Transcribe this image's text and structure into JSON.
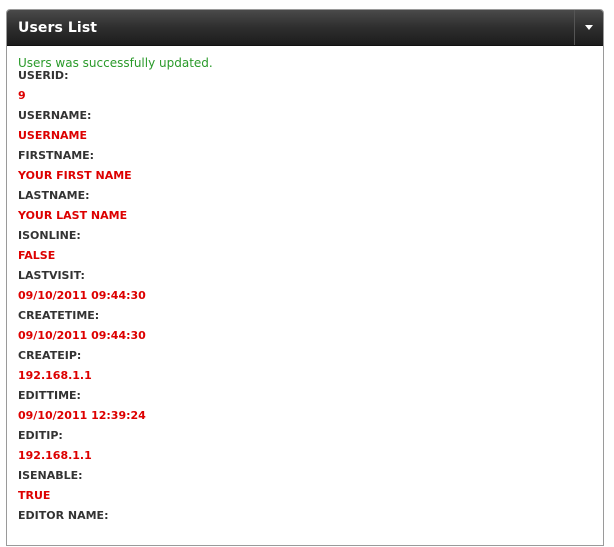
{
  "panel": {
    "title": "Users List",
    "toggle_icon": "chevron-down-icon"
  },
  "message": "Users was successfully updated.",
  "fields": [
    {
      "label": "USERID:",
      "value": "9"
    },
    {
      "label": "USERNAME:",
      "value": "USERNAME"
    },
    {
      "label": "FIRSTNAME:",
      "value": "YOUR FIRST NAME"
    },
    {
      "label": "LASTNAME:",
      "value": "YOUR LAST NAME"
    },
    {
      "label": "ISONLINE:",
      "value": "FALSE"
    },
    {
      "label": "LASTVISIT:",
      "value": "09/10/2011 09:44:30"
    },
    {
      "label": "CREATETIME:",
      "value": "09/10/2011 09:44:30"
    },
    {
      "label": "CREATEIP:",
      "value": "192.168.1.1"
    },
    {
      "label": "EDITTIME:",
      "value": "09/10/2011 12:39:24"
    },
    {
      "label": "EDITIP:",
      "value": "192.168.1.1"
    },
    {
      "label": "ISENABLE:",
      "value": "TRUE"
    },
    {
      "label": "EDITOR NAME:",
      "value": ""
    }
  ],
  "colors": {
    "header_bg": "#2e2e2e",
    "success": "#2a9a2a",
    "value": "#dd0000",
    "label": "#333333"
  }
}
